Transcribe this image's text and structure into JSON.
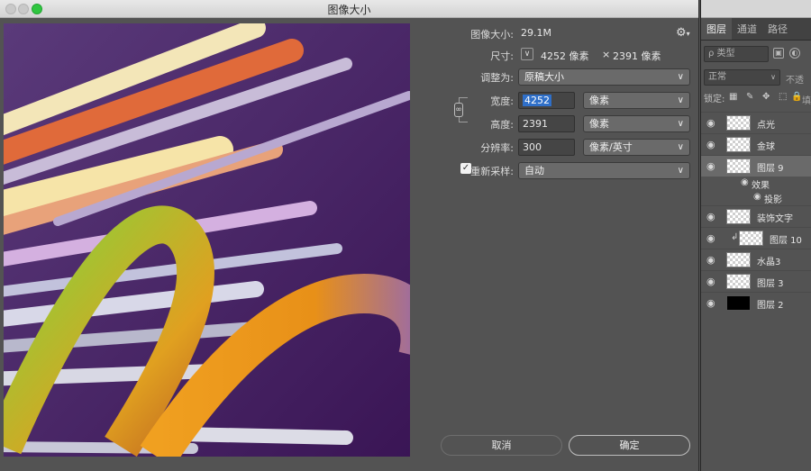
{
  "window": {
    "title": "图像大小"
  },
  "info": {
    "image_size_label": "图像大小:",
    "image_size_value": "29.1M",
    "dimensions_label": "尺寸:",
    "dim_width": "4252 像素",
    "dim_sep": "×",
    "dim_height": "2391 像素"
  },
  "form": {
    "fit_to_label": "调整为:",
    "fit_to_value": "原稿大小",
    "width_label": "宽度:",
    "width_value": "4252",
    "width_unit": "像素",
    "height_label": "高度:",
    "height_value": "2391",
    "height_unit": "像素",
    "resolution_label": "分辨率:",
    "resolution_value": "300",
    "resolution_unit": "像素/英寸",
    "resample_label": "重新采样:",
    "resample_value": "自动",
    "resample_checked": true
  },
  "buttons": {
    "cancel": "取消",
    "ok": "确定"
  },
  "panel": {
    "tabs": [
      "图层",
      "通道",
      "路径"
    ],
    "filter_label": "ρ 类型",
    "blend_mode": "正常",
    "opacity_label": "不透",
    "lock_label": "锁定:",
    "fill_label": "填",
    "layers": [
      {
        "name": "点光"
      },
      {
        "name": "金球"
      },
      {
        "name": "图层 9"
      },
      {
        "name": "效果"
      },
      {
        "name": "投影"
      },
      {
        "name": "装饰文字"
      },
      {
        "name": "图层 10"
      },
      {
        "name": "水晶3"
      },
      {
        "name": "图层 3"
      },
      {
        "name": "图层 2"
      }
    ]
  },
  "colors": {
    "selection": "#2f6fc8",
    "bg": "#535353",
    "zoom_button": "#2fc640"
  }
}
